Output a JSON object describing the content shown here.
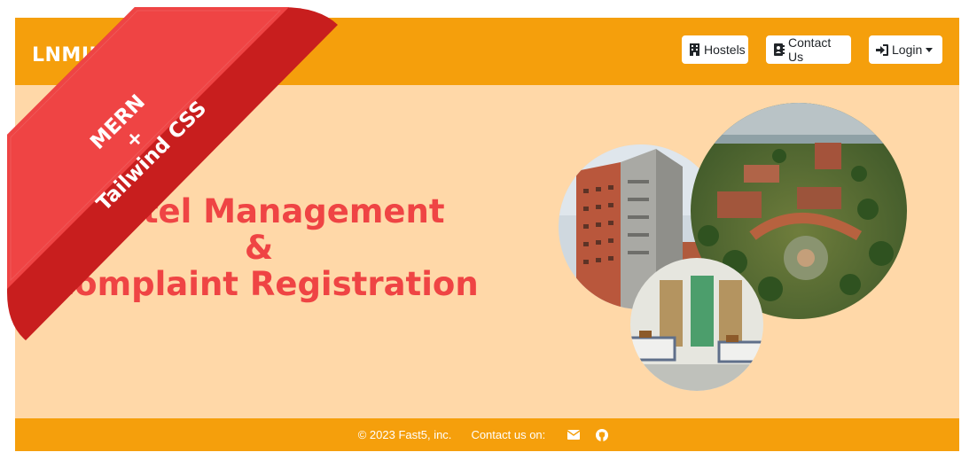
{
  "navbar": {
    "brand": "LNMIIT",
    "hostels_label": "Hostels",
    "contact_label": "Contact Us",
    "login_label": "Login"
  },
  "hero": {
    "line1": "Hostel Management",
    "line2": "&",
    "line3": "Complaint Registration"
  },
  "ribbon": {
    "line1": "MERN",
    "line2": "+",
    "line3": "Tailwind CSS"
  },
  "footer": {
    "copyright": "© 2023 Fast5, inc.",
    "contact_label": "Contact us on:"
  },
  "icons": {
    "hostels": "building-icon",
    "contact": "address-book-icon",
    "login": "sign-in-icon",
    "email": "envelope-icon",
    "github": "github-icon"
  },
  "colors": {
    "navbar": "#f59f0c",
    "background": "#ffd8a8",
    "title": "#ef4444",
    "ribbon": "#ef4444"
  }
}
